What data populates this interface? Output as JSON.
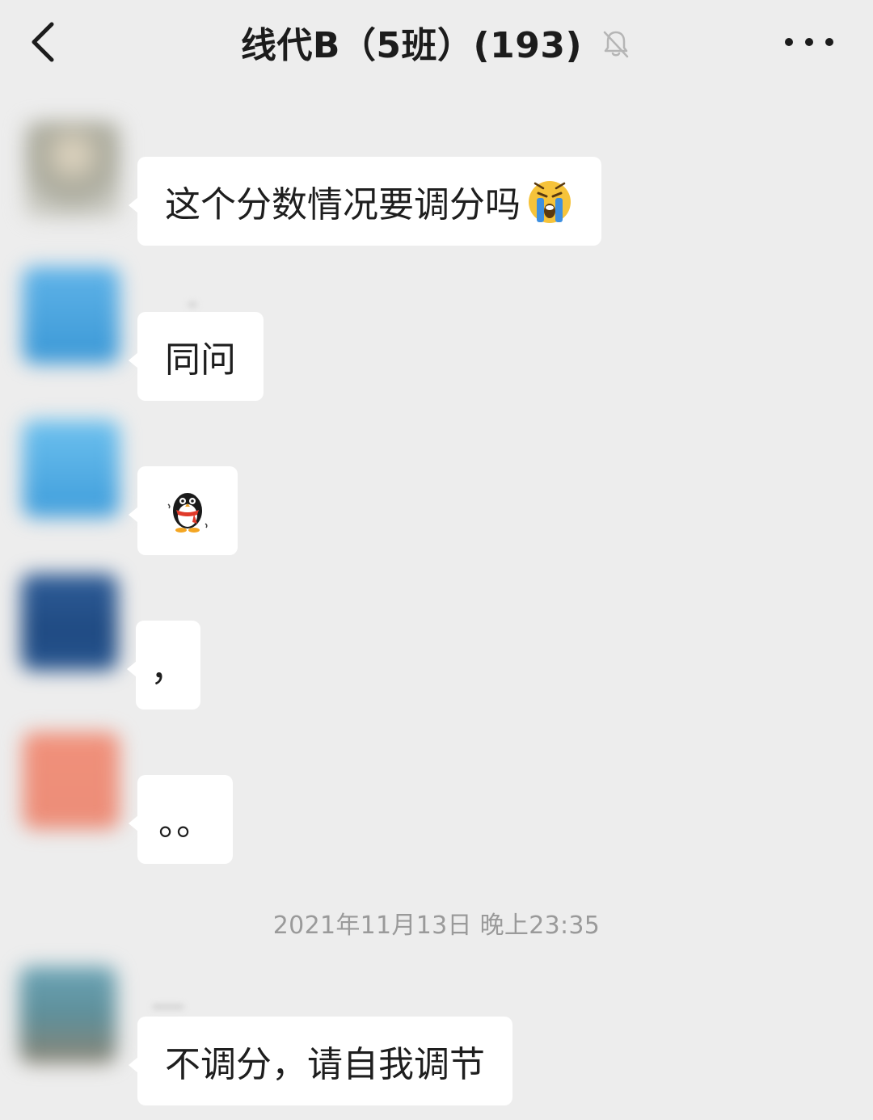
{
  "header": {
    "title": "线代B（5班）(193)",
    "back_icon": "chevron-left-icon",
    "mute_icon": "bell-off-icon",
    "more_icon": "more-dots-icon"
  },
  "messages": [
    {
      "text": "这个分数情况要调分吗",
      "emoji": "loudly-crying-face-icon"
    },
    {
      "text": "同问"
    },
    {
      "emoji": "qq-penguin-sticker-icon"
    },
    {
      "text": "，"
    },
    {
      "text": "。。"
    },
    {
      "text": "不调分，请自我调节"
    }
  ],
  "timestamp": "2021年11月13日 晚上23:35",
  "colors": {
    "background": "#ededed",
    "bubble": "#ffffff",
    "timestamp": "#9a9a9a"
  }
}
